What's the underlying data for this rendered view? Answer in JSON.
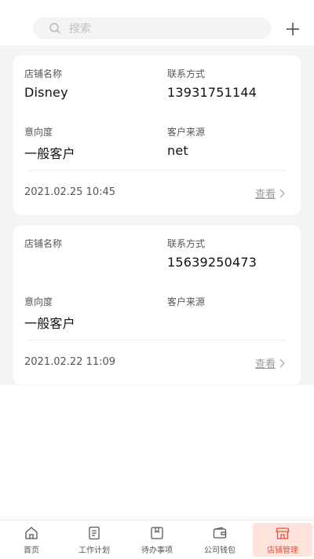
{
  "header": {
    "search_placeholder": "搜索",
    "icons": {
      "search": "search-icon",
      "add": "plus-icon"
    }
  },
  "cards": [
    {
      "shop_name_label": "店铺名称",
      "shop_name": "Disney",
      "contact_label": "联系方式",
      "contact": "13931751144",
      "intent_label": "意向度",
      "intent": "一般客户",
      "source_label": "客户来源",
      "source": "net",
      "date": "2021.02.25 10:45",
      "view_label": "查看"
    },
    {
      "shop_name_label": "店铺名称",
      "shop_name": "",
      "contact_label": "联系方式",
      "contact": "15639250473",
      "intent_label": "意向度",
      "intent": "一般客户",
      "source_label": "客户来源",
      "source": "",
      "date": "2021.02.22 11:09",
      "view_label": "查看"
    }
  ],
  "nav": [
    {
      "label": "首页",
      "icon": "home-icon"
    },
    {
      "label": "工作计划",
      "icon": "plan-icon"
    },
    {
      "label": "待办事项",
      "icon": "todo-icon"
    },
    {
      "label": "公司钱包",
      "icon": "wallet-icon"
    },
    {
      "label": "店铺管理",
      "icon": "store-icon",
      "active": true
    }
  ],
  "colors": {
    "accent": "#e0553f",
    "accent_bg": "#fde3dc",
    "page_bg": "#f5f5f5"
  }
}
